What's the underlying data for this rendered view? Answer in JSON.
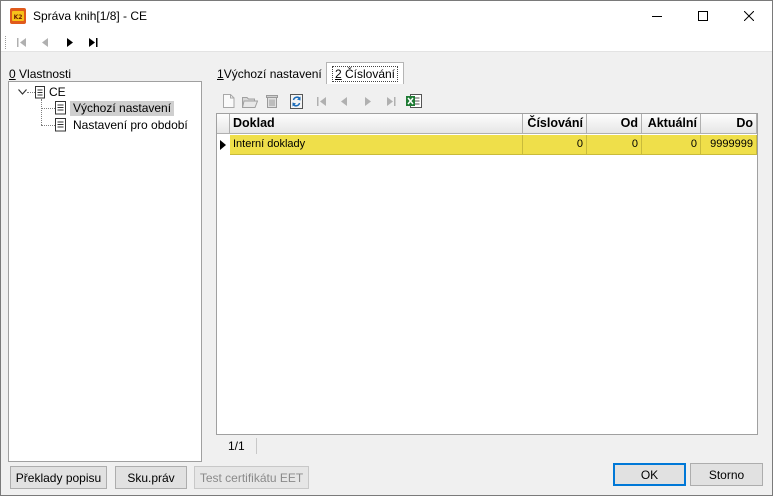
{
  "window": {
    "title": "Správa knih[1/8] - CE",
    "controls": [
      "minimize-icon",
      "maximize-icon",
      "close-icon"
    ]
  },
  "toolbar": {
    "nav": [
      "first-record-icon",
      "previous-record-icon",
      "next-record-icon",
      "last-record-icon"
    ]
  },
  "left_panel": {
    "hotkey": "0",
    "label_rest": " Vlastnosti",
    "tree": {
      "root": "CE",
      "children": [
        "Výchozí nastavení",
        "Nastavení pro období"
      ],
      "selected": "Výchozí nastavení"
    }
  },
  "tabs": [
    {
      "hotkey": "1",
      "label_rest": " Výchozí nastavení",
      "active": false
    },
    {
      "hotkey": "2",
      "label_rest": " Číslování",
      "active": true
    }
  ],
  "grid_toolbar": [
    "new-icon",
    "open-icon",
    "delete-icon",
    "refresh-icon",
    "first-icon",
    "previous-icon",
    "next-icon",
    "last-icon",
    "excel-export-icon"
  ],
  "grid": {
    "columns": [
      "Doklad",
      "Číslování",
      "Od",
      "Aktuální",
      "Do"
    ],
    "rows": [
      {
        "doklad": "Interní doklady",
        "cislovani": "0",
        "od": "0",
        "aktualni": "0",
        "do": "9999999"
      }
    ],
    "row_color": "#efdf4a"
  },
  "status": {
    "record": "1/1"
  },
  "buttons": {
    "preklady": "Překlady popisu",
    "sku_prav": "Sku.práv",
    "test_eet": "Test certifikátu EET",
    "ok": "OK",
    "storno": "Storno"
  },
  "colors": {
    "accent": "#0078d7",
    "selected_row": "#efdf4a",
    "tree_selection": "#cfcfcf"
  }
}
